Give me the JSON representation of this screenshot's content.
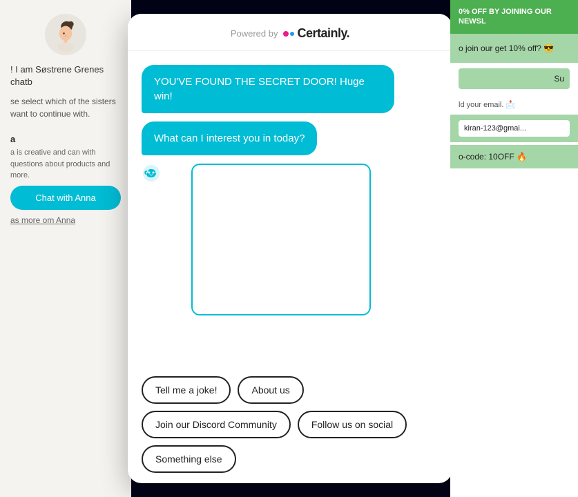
{
  "header": {
    "powered_by": "Powered by",
    "brand_name": "Certainly."
  },
  "chat": {
    "messages": [
      {
        "type": "bot",
        "text": "YOU'VE FOUND THE SECRET DOOR! Huge win!"
      },
      {
        "type": "bot",
        "text": "What can I interest you in today?"
      }
    ],
    "quick_replies": [
      {
        "label": "Tell me a joke!"
      },
      {
        "label": "About us"
      },
      {
        "label": "Join our Discord Community"
      },
      {
        "label": "Follow us on social"
      },
      {
        "label": "Something else"
      }
    ]
  },
  "left_panel": {
    "intro": "! I am Søstrene Grenes chatb",
    "description": "se select which of the sisters\nwant to continue with.",
    "anna_label": "a",
    "anna_description": "a is creative and can\nwith questions about\n products and more.",
    "chat_button": "Chat with Anna",
    "see_more": "as more om Anna"
  },
  "right_panel": {
    "banner": "0% OFF BY JOINING OUR NEWSL",
    "promo_intro": "o join our\nget 10% off? 😎",
    "subscribe_placeholder": "Su",
    "add_email": "ld your email. 📩",
    "email_value": "kiran-123@gmai...",
    "promo_code": "o-code: 10OFF 🔥"
  },
  "icons": {
    "bot_icon": "🤖",
    "certainly_dot1": "pink",
    "certainly_dot2": "blue"
  }
}
